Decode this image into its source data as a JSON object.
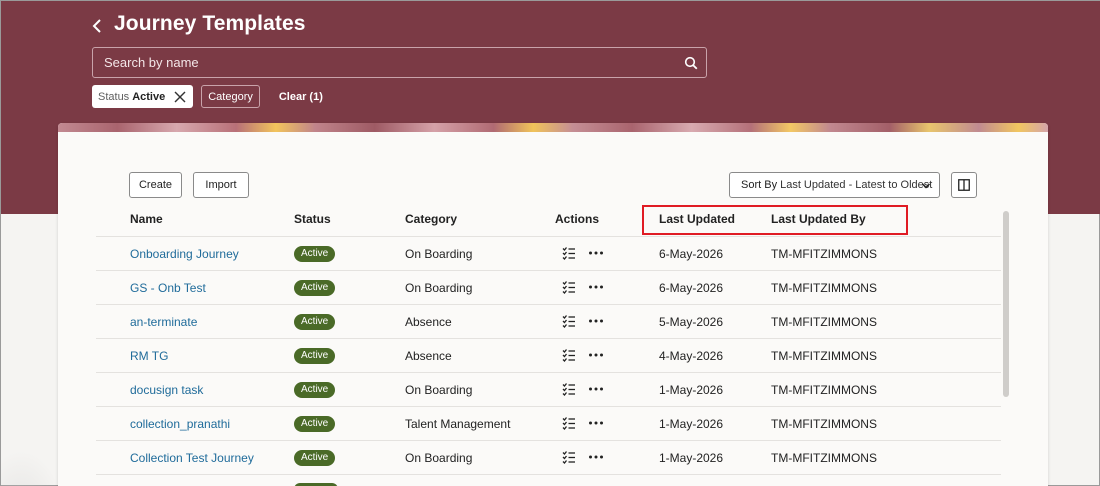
{
  "header": {
    "title": "Journey Templates",
    "search_placeholder": "Search by name"
  },
  "filters": {
    "status_key": "Status",
    "status_value": "Active",
    "category_label": "Category",
    "clear_label": "Clear (1)"
  },
  "toolbar": {
    "create_label": "Create",
    "import_label": "Import",
    "sort_key": "Sort By",
    "sort_value": "Last Updated - Latest to Oldest"
  },
  "table": {
    "columns": [
      "Name",
      "Status",
      "Category",
      "Actions",
      "Last Updated",
      "Last Updated By"
    ],
    "rows": [
      {
        "name": "Onboarding Journey",
        "status": "Active",
        "category": "On Boarding",
        "updated": "6-May-2026",
        "updated_by": "TM-MFITZIMMONS"
      },
      {
        "name": "GS - Onb Test",
        "status": "Active",
        "category": "On Boarding",
        "updated": "6-May-2026",
        "updated_by": "TM-MFITZIMMONS"
      },
      {
        "name": "an-terminate",
        "status": "Active",
        "category": "Absence",
        "updated": "5-May-2026",
        "updated_by": "TM-MFITZIMMONS"
      },
      {
        "name": "RM TG",
        "status": "Active",
        "category": "Absence",
        "updated": "4-May-2026",
        "updated_by": "TM-MFITZIMMONS"
      },
      {
        "name": "docusign task",
        "status": "Active",
        "category": "On Boarding",
        "updated": "1-May-2026",
        "updated_by": "TM-MFITZIMMONS"
      },
      {
        "name": "collection_pranathi",
        "status": "Active",
        "category": "Talent Management",
        "updated": "1-May-2026",
        "updated_by": "TM-MFITZIMMONS"
      },
      {
        "name": "Collection Test Journey",
        "status": "Active",
        "category": "On Boarding",
        "updated": "1-May-2026",
        "updated_by": "TM-MFITZIMMONS"
      }
    ]
  },
  "colors": {
    "header_bg": "#7b3a45",
    "status_badge": "#4a6a27",
    "link": "#1f6b9a",
    "highlight_box": "#e01b24"
  },
  "icons": {
    "back": "chevron-left-icon",
    "search": "search-icon",
    "chip_remove": "close-icon",
    "sort_dropdown": "chevron-down-icon",
    "panel_toggle": "panel-layout-icon",
    "row_tasks": "checklist-icon",
    "row_more": "more-horizontal-icon"
  }
}
